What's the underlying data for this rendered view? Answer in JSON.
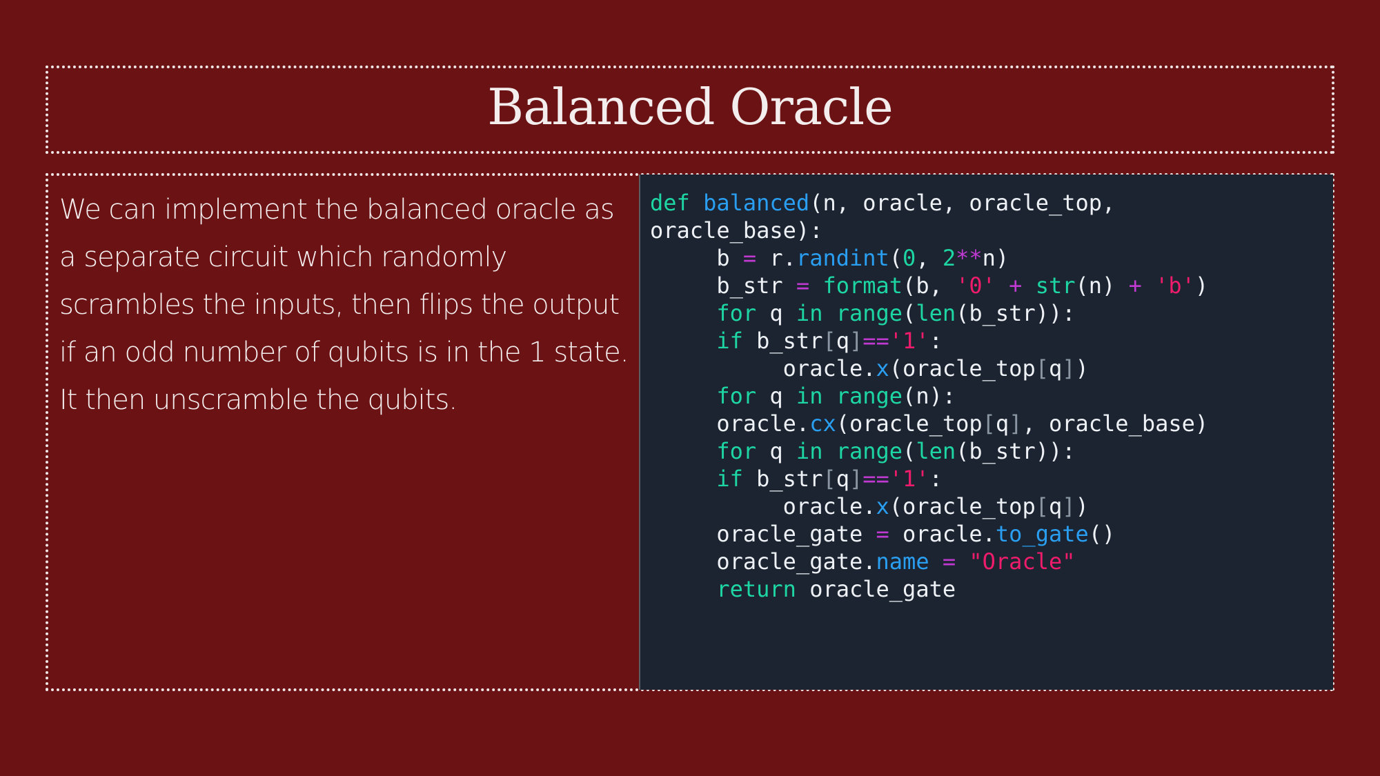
{
  "slide": {
    "title": "Balanced Oracle",
    "body": "We can implement the balanced oracle as a separate circuit which randomly scrambles the inputs, then flips the output if an odd number of qubits is in the 1 state. It then unscramble the qubits."
  },
  "code": {
    "lines": [
      "def balanced(n, oracle, oracle_top,",
      "oracle_base):",
      "     b = r.randint(0, 2**n)",
      "     b_str = format(b, '0' + str(n) + 'b')",
      "     for q in range(len(b_str)):",
      "     if b_str[q]=='1':",
      "          oracle.x(oracle_top[q])",
      "     for q in range(n):",
      "     oracle.cx(oracle_top[q], oracle_base)",
      "     for q in range(len(b_str)):",
      "     if b_str[q]=='1':",
      "          oracle.x(oracle_top[q])",
      "     oracle_gate = oracle.to_gate()",
      "     oracle_gate.name = \"Oracle\"",
      "     return oracle_gate"
    ]
  },
  "colors": {
    "background": "#6b1214",
    "code_background": "#1b2430",
    "keyword": "#1ed6a3",
    "function": "#2a9ff2",
    "string": "#ef1c6c",
    "operator": "#c03ad2"
  }
}
